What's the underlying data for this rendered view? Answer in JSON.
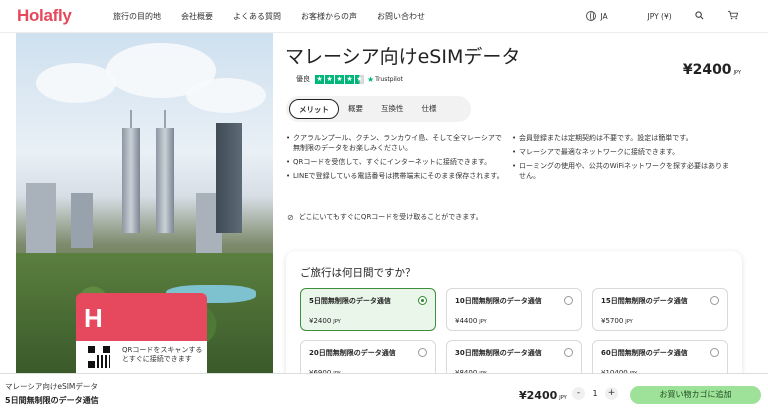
{
  "header": {
    "logo": "Holafly",
    "nav": [
      "旅行の目的地",
      "会社概要",
      "よくある質問",
      "お客様からの声",
      "お問い合わせ"
    ],
    "language": "JA",
    "currency": "JPY (¥)"
  },
  "hero": {
    "qr_text": "QRコードをスキャンするとすぐに接続できます"
  },
  "product": {
    "title": "マレーシア向けeSIMデータ",
    "price": "¥2400",
    "price_unit": "JPY",
    "rating_label": "優良",
    "rating_stars": 4.5,
    "trustpilot": "Trustpilot",
    "tabs": [
      "メリット",
      "概要",
      "互換性",
      "仕様"
    ],
    "active_tab": 0,
    "bullets_left": [
      "クアラルンプール、クチン、ランカウイ島、そして全マレーシアで無制限のデータをお楽しみください。",
      "QRコードを受信して、すぐにインターネットに接続できます。",
      "LINEで登録している電話番号は携帯端末にそのまま保存されます。"
    ],
    "bullets_right": [
      "会員登録または定期契約は不要です。設定は簡単です。",
      "マレーシアで最適なネットワークに接続できます。",
      "ローミングの使用や、公共のWiFiネットワークを探す必要はありません。"
    ],
    "qr_note": "どこにいてもすぐにQRコードを受け取ることができます。"
  },
  "plans": {
    "title": "ご旅行は何日間ですか？",
    "items": [
      {
        "name": "5日間無制限のデータ通信",
        "price": "¥2400",
        "unit": "JPY",
        "selected": true
      },
      {
        "name": "10日間無制限のデータ通信",
        "price": "¥4400",
        "unit": "JPY",
        "selected": false
      },
      {
        "name": "15日間無制限のデータ通信",
        "price": "¥5700",
        "unit": "JPY",
        "selected": false
      },
      {
        "name": "20日間無制限のデータ通信",
        "price": "¥6900",
        "unit": "JPY",
        "selected": false
      },
      {
        "name": "30日間無制限のデータ通信",
        "price": "¥8400",
        "unit": "JPY",
        "selected": false
      },
      {
        "name": "60日間無制限のデータ通信",
        "price": "¥10400",
        "unit": "JPY",
        "selected": false
      }
    ]
  },
  "bottom_bar": {
    "product_name": "マレーシア向けeSIMデータ",
    "plan_name": "5日間無制限のデータ通信",
    "price": "¥2400",
    "price_unit": "JPY",
    "minus": "-",
    "quantity": "1",
    "plus": "+",
    "cta": "お買い物カゴに追加"
  },
  "colors": {
    "brand": "#e6485d",
    "selected_border": "#3e8e3e",
    "cta_bg": "#9ee29a",
    "trustpilot_green": "#00b67a"
  },
  "icons": [
    "globe-icon",
    "search-icon",
    "cart-icon",
    "qr-code-icon",
    "link-icon",
    "star-icon"
  ]
}
